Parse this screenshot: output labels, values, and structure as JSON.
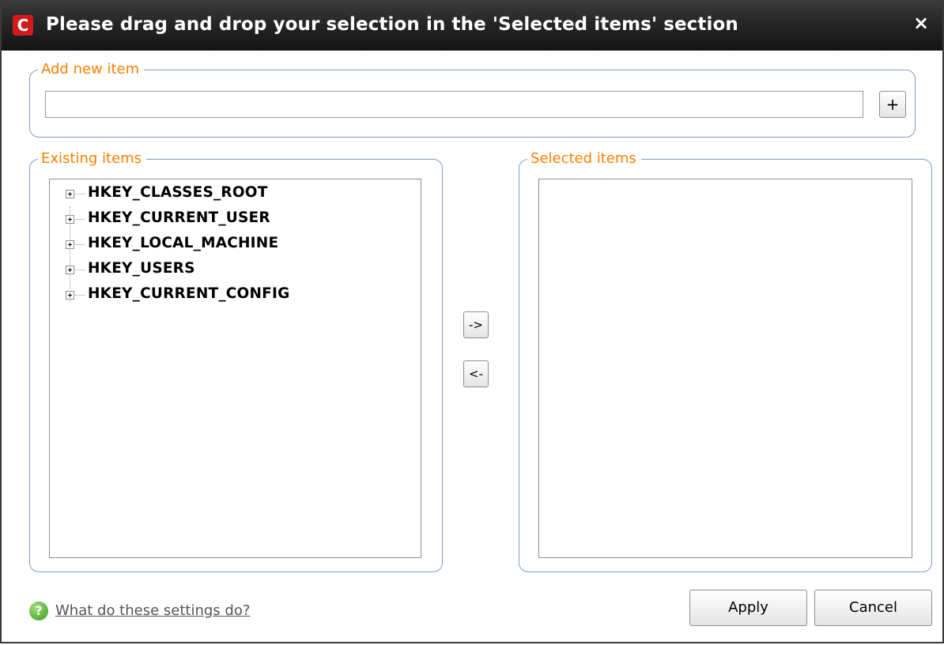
{
  "window": {
    "title": "Please drag and drop your selection in the 'Selected items' section",
    "logo_letter": "C",
    "close_glyph": "×",
    "accent_color": "#ff7f00",
    "titlebar_color": "#262626",
    "group_border_color": "#7e9bc8"
  },
  "add_new": {
    "legend": "Add new item",
    "input_value": "",
    "add_button_label": "+"
  },
  "existing": {
    "legend": "Existing items",
    "items": [
      {
        "label": "HKEY_CLASSES_ROOT",
        "icon": "plus-expander-icon"
      },
      {
        "label": "HKEY_CURRENT_USER",
        "icon": "plus-expander-icon"
      },
      {
        "label": "HKEY_LOCAL_MACHINE",
        "icon": "plus-expander-icon"
      },
      {
        "label": "HKEY_USERS",
        "icon": "plus-expander-icon"
      },
      {
        "label": "HKEY_CURRENT_CONFIG",
        "icon": "plus-expander-icon"
      }
    ]
  },
  "transfer": {
    "add_label": "->",
    "remove_label": "<-"
  },
  "selected": {
    "legend": "Selected items",
    "items": []
  },
  "footer": {
    "help_icon": "help-question-icon",
    "help_glyph": "?",
    "help_link": "What do these settings do?",
    "apply_label": "Apply",
    "cancel_label": "Cancel"
  }
}
